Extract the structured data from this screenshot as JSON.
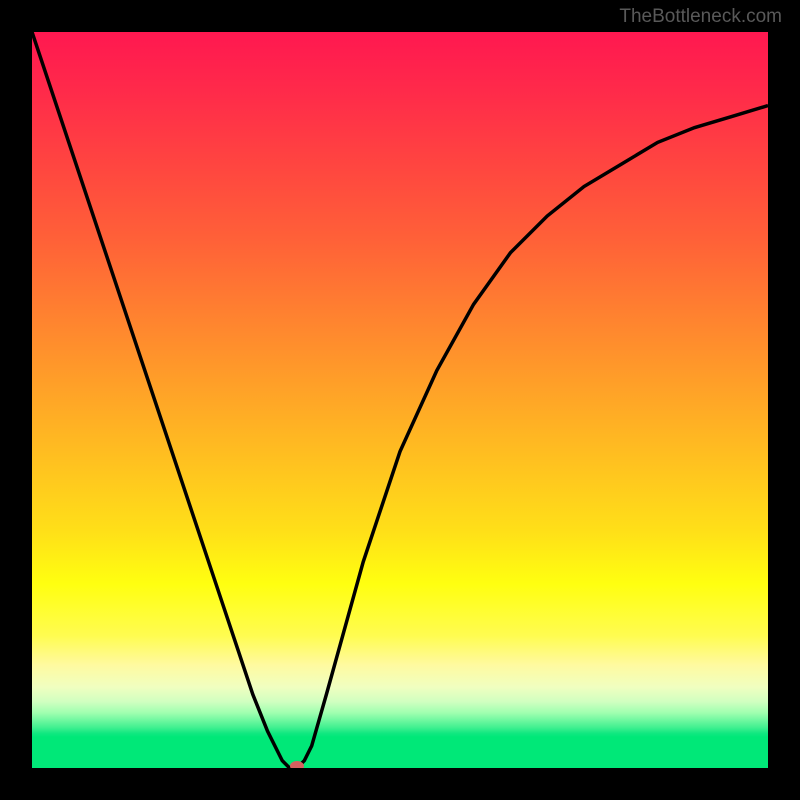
{
  "watermark": "TheBottleneck.com",
  "colors": {
    "watermark_text": "#595959",
    "background": "#000000",
    "curve": "#000000",
    "marker": "#d86060"
  },
  "chart_data": {
    "type": "line",
    "title": "",
    "xlabel": "",
    "ylabel": "",
    "xlim": [
      0,
      100
    ],
    "ylim": [
      0,
      100
    ],
    "series": [
      {
        "name": "bottleneck-curve",
        "description": "V-shaped bottleneck percentage curve with sharp minimum",
        "x": [
          0,
          5,
          10,
          15,
          20,
          25,
          28,
          30,
          32,
          34,
          35,
          36,
          37,
          38,
          40,
          45,
          50,
          55,
          60,
          65,
          70,
          75,
          80,
          85,
          90,
          95,
          100
        ],
        "y": [
          100,
          85,
          70,
          55,
          40,
          25,
          16,
          10,
          5,
          1,
          0,
          0,
          1,
          3,
          10,
          28,
          43,
          54,
          63,
          70,
          75,
          79,
          82,
          85,
          87,
          88.5,
          90
        ]
      }
    ],
    "marker": {
      "x": 36,
      "y": 0,
      "description": "red oval marker at curve minimum"
    },
    "gradient_stops": [
      {
        "pos": 0,
        "color": "#ff1850"
      },
      {
        "pos": 75,
        "color": "#ffff10"
      },
      {
        "pos": 96,
        "color": "#00e878"
      }
    ]
  }
}
